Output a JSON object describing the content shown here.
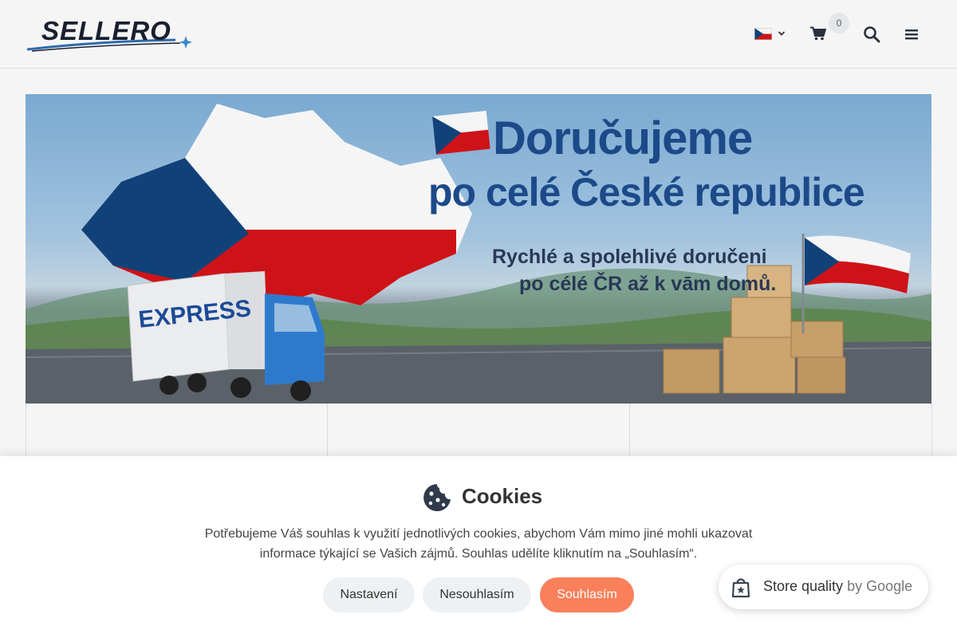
{
  "header": {
    "logo_text": "SELLERO",
    "cart_count": "0"
  },
  "banner": {
    "headline_line1": "Doručujeme",
    "headline_line2": "po celé České republice",
    "sub_line1": "Rychlé a spolehlivé doručeni",
    "sub_line2": "po célé ČR až k vām domů.",
    "truck_label": "EXPRESS"
  },
  "cookies": {
    "title": "Cookies",
    "text": "Potřebujeme Váš souhlas k využití jednotlivých cookies, abychom Vám mimo jiné mohli ukazovat informace týkající se Vašich zájmů. Souhlas udělíte kliknutím na „Souhlasím“.",
    "settings_label": "Nastavení",
    "decline_label": "Nesouhlasím",
    "accept_label": "Souhlasím"
  },
  "google_badge": {
    "label": "Store quality",
    "by": "by Google"
  },
  "colors": {
    "accent": "#f9805a",
    "brand_dark": "#1b2130",
    "brand_blue": "#1e4e8f"
  },
  "icons": {
    "flag": "czech-flag-icon",
    "cart": "cart-icon",
    "search": "search-icon",
    "menu": "hamburger-menu-icon",
    "cookie": "cookie-icon",
    "badge": "google-store-quality-icon"
  }
}
